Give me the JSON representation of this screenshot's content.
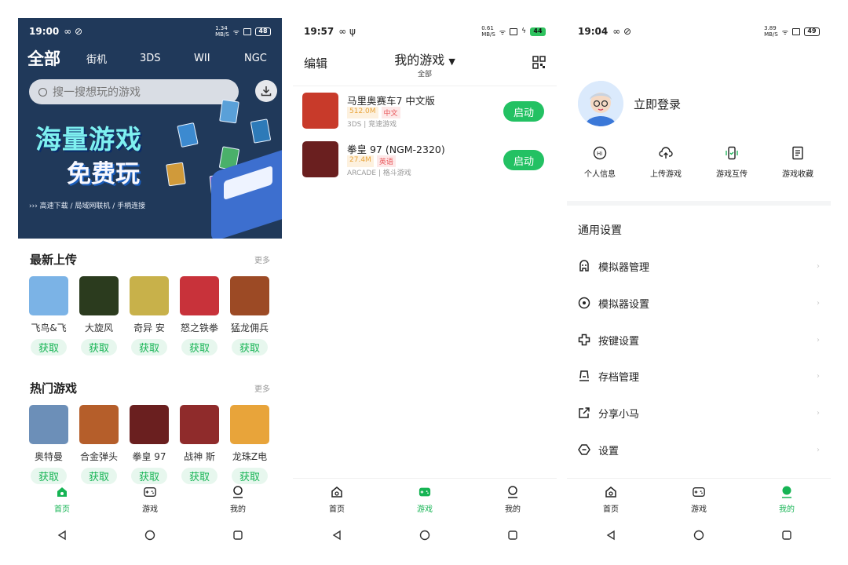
{
  "screen1": {
    "status": {
      "time": "19:00",
      "icons": "∞ ⊘",
      "net": "1.34\nMB/S",
      "battery": "48"
    },
    "categories": {
      "current": "全部",
      "others": [
        "街机",
        "3DS",
        "WII",
        "NGC"
      ]
    },
    "search": {
      "placeholder": "搜一搜想玩的游戏"
    },
    "banner": {
      "line1": "海量游戏",
      "line2": "免费玩",
      "sub": "››› 高速下载 / 局域网联机 / 手柄连接"
    },
    "latest": {
      "title": "最新上传",
      "more": "更多",
      "games": [
        {
          "name": "飞鸟&飞",
          "action": "获取",
          "color": "#7bb3e6"
        },
        {
          "name": "大旋风",
          "action": "获取",
          "color": "#2b3b1e"
        },
        {
          "name": "奇异 安",
          "action": "获取",
          "color": "#c8b14a"
        },
        {
          "name": "怒之铁拳",
          "action": "获取",
          "color": "#c8323a"
        },
        {
          "name": "猛龙佣兵",
          "action": "获取",
          "color": "#9c4a25"
        }
      ]
    },
    "hot": {
      "title": "热门游戏",
      "more": "更多",
      "games": [
        {
          "name": "奥特曼",
          "action": "获取",
          "color": "#6c8fb8"
        },
        {
          "name": "合金弹头",
          "action": "获取",
          "color": "#b55e2a"
        },
        {
          "name": "拳皇 97",
          "action": "获取",
          "color": "#6a1f1f"
        },
        {
          "name": "战神 斯",
          "action": "获取",
          "color": "#8f2b2b"
        },
        {
          "name": "龙珠Z电",
          "action": "获取",
          "color": "#e8a43a"
        }
      ]
    }
  },
  "screen2": {
    "status": {
      "time": "19:57",
      "icons": "∞ ψ",
      "net": "0.61\nMB/S",
      "battery": "44"
    },
    "edit": "编辑",
    "title": "我的游戏",
    "subtitle": "全部",
    "games": [
      {
        "name": "马里奥赛车7 中文版",
        "size": "512.0M",
        "lang": "中文",
        "meta": "3DS | 竞速游戏",
        "action": "启动",
        "color": "#c83a2a"
      },
      {
        "name": "拳皇 97 (NGM-2320)",
        "size": "27.4M",
        "lang": "英语",
        "meta": "ARCADE | 格斗游戏",
        "action": "启动",
        "color": "#6a1f1f"
      }
    ]
  },
  "screen3": {
    "status": {
      "time": "19:04",
      "icons": "∞ ⊘",
      "net": "3.89\nMB/S",
      "battery": "49"
    },
    "login": "立即登录",
    "quick": [
      "个人信息",
      "上传游戏",
      "游戏互传",
      "游戏收藏"
    ],
    "settings_title": "通用设置",
    "settings": [
      "模拟器管理",
      "模拟器设置",
      "按键设置",
      "存档管理",
      "分享小马",
      "设置"
    ]
  },
  "nav": {
    "home": "首页",
    "games": "游戏",
    "mine": "我的"
  },
  "colors": {
    "accent": "#16b454",
    "hero_bg": "#20395a"
  }
}
